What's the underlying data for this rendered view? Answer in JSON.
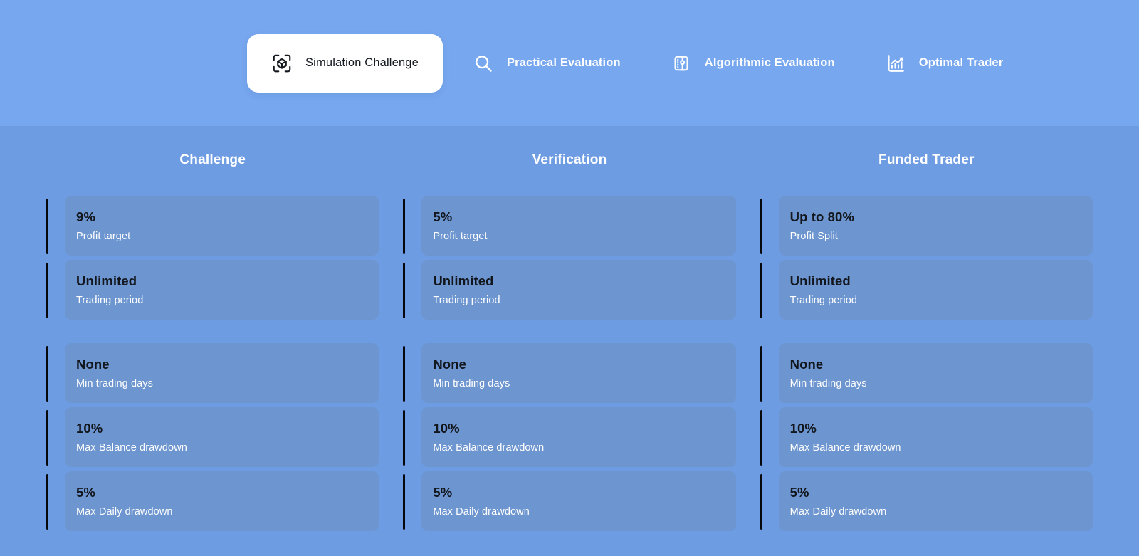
{
  "tabs": [
    {
      "id": "simulation-challenge",
      "label": "Simulation Challenge",
      "icon": "cube-scan-icon",
      "active": true
    },
    {
      "id": "practical-evaluation",
      "label": "Practical Evaluation",
      "icon": "magnifier-icon",
      "active": false
    },
    {
      "id": "algorithmic-evaluation",
      "label": "Algorithmic Evaluation",
      "icon": "server-data-icon",
      "active": false
    },
    {
      "id": "optimal-trader",
      "label": "Optimal Trader",
      "icon": "bar-chart-icon",
      "active": false
    }
  ],
  "colors": {
    "header_background": "#77a7ef",
    "body_background": "#6e9ce3",
    "card_background": "#6d95cf",
    "accent_bar": "#06080d",
    "value_text": "#12161d",
    "label_text": "#ffffff"
  },
  "columns": [
    {
      "title": "Challenge",
      "groups": [
        [
          {
            "value": "9%",
            "label": "Profit target"
          },
          {
            "value": "Unlimited",
            "label": "Trading period"
          }
        ],
        [
          {
            "value": "None",
            "label": "Min trading days"
          },
          {
            "value": "10%",
            "label": "Max Balance drawdown"
          },
          {
            "value": "5%",
            "label": "Max Daily drawdown"
          }
        ]
      ]
    },
    {
      "title": "Verification",
      "groups": [
        [
          {
            "value": "5%",
            "label": "Profit target"
          },
          {
            "value": "Unlimited",
            "label": "Trading period"
          }
        ],
        [
          {
            "value": "None",
            "label": "Min trading days"
          },
          {
            "value": "10%",
            "label": "Max Balance drawdown"
          },
          {
            "value": "5%",
            "label": "Max Daily drawdown"
          }
        ]
      ]
    },
    {
      "title": "Funded Trader",
      "groups": [
        [
          {
            "value": "Up to 80%",
            "label": "Profit Split"
          },
          {
            "value": "Unlimited",
            "label": "Trading period"
          }
        ],
        [
          {
            "value": "None",
            "label": "Min trading days"
          },
          {
            "value": "10%",
            "label": "Max Balance drawdown"
          },
          {
            "value": "5%",
            "label": "Max Daily drawdown"
          }
        ]
      ]
    }
  ]
}
